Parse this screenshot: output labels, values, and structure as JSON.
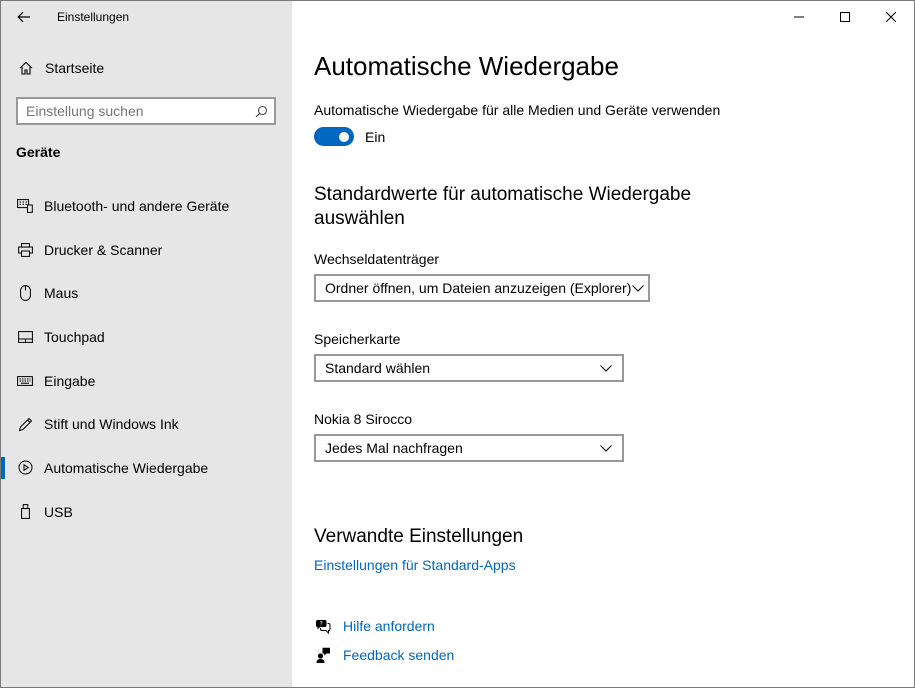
{
  "window": {
    "title": "Einstellungen"
  },
  "sidebar": {
    "home_label": "Startseite",
    "search": {
      "placeholder": "Einstellung suchen"
    },
    "section": "Geräte",
    "items": [
      {
        "label": "Bluetooth- und andere Geräte",
        "icon": "bluetooth-devices-icon"
      },
      {
        "label": "Drucker & Scanner",
        "icon": "printer-icon"
      },
      {
        "label": "Maus",
        "icon": "mouse-icon"
      },
      {
        "label": "Touchpad",
        "icon": "touchpad-icon"
      },
      {
        "label": "Eingabe",
        "icon": "keyboard-icon"
      },
      {
        "label": "Stift und Windows Ink",
        "icon": "pen-icon"
      },
      {
        "label": "Automatische Wiedergabe",
        "icon": "autoplay-icon",
        "selected": true
      },
      {
        "label": "USB",
        "icon": "usb-icon"
      }
    ]
  },
  "main": {
    "title": "Automatische Wiedergabe",
    "toggle": {
      "description": "Automatische Wiedergabe für alle Medien und Geräte verwenden",
      "state": "Ein",
      "on": true
    },
    "defaults_title": "Standardwerte für automatische Wiedergabe auswählen",
    "fields": [
      {
        "label": "Wechseldatenträger",
        "value": "Ordner öffnen, um Dateien anzuzeigen (Explorer)"
      },
      {
        "label": "Speicherkarte",
        "value": "Standard wählen"
      },
      {
        "label": "Nokia 8 Sirocco",
        "value": "Jedes Mal nachfragen"
      }
    ],
    "related": {
      "title": "Verwandte Einstellungen",
      "link": "Einstellungen für Standard-Apps"
    },
    "help": {
      "get_help": "Hilfe anfordern",
      "feedback": "Feedback senden"
    }
  },
  "colors": {
    "accent": "#0067c0",
    "sidebar_bg": "#e6e6e6"
  }
}
